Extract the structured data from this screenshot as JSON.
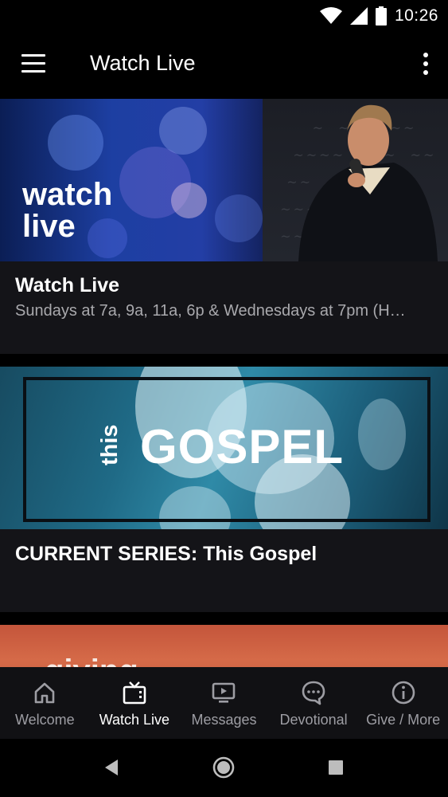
{
  "status_bar": {
    "time": "10:26",
    "icons": [
      "wifi-icon",
      "signal-icon",
      "battery-icon"
    ]
  },
  "app_bar": {
    "title": "Watch Live",
    "menu_icon": "hamburger-menu-icon",
    "overflow_icon": "more-vert-icon"
  },
  "cards": [
    {
      "image_text_line1": "watch",
      "image_text_line2": "live",
      "title": "Watch Live",
      "subtitle": "Sundays at 7a, 9a, 11a, 6p & Wednesdays at 7pm (H…"
    },
    {
      "image_text_small": "this",
      "image_text_large": "GOSPEL",
      "title": "CURRENT SERIES:  This Gospel"
    },
    {
      "image_text": "giving"
    }
  ],
  "bottom_nav": {
    "items": [
      {
        "label": "Welcome",
        "icon": "home-icon",
        "active": false
      },
      {
        "label": "Watch Live",
        "icon": "tv-icon",
        "active": true
      },
      {
        "label": "Messages",
        "icon": "video-player-icon",
        "active": false
      },
      {
        "label": "Devotional",
        "icon": "chat-bubble-icon",
        "active": false
      },
      {
        "label": "Give / More",
        "icon": "info-icon",
        "active": false
      }
    ]
  },
  "system_nav": {
    "icons": [
      "back-icon",
      "home-circle-icon",
      "recents-icon"
    ]
  },
  "colors": {
    "background": "#000000",
    "card": "#141418",
    "active_nav": "#ffffff",
    "inactive_nav": "#9d9da3"
  }
}
